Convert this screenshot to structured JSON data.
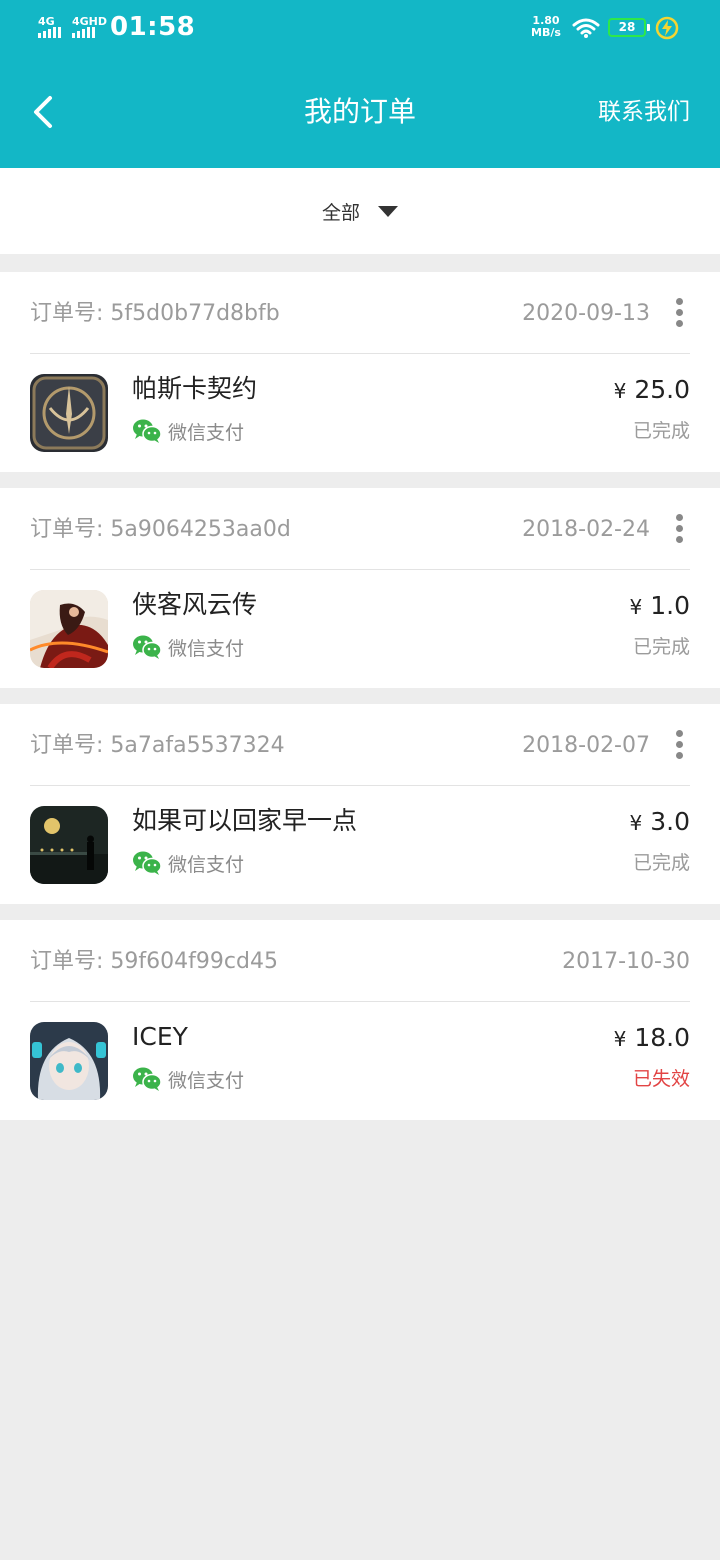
{
  "status_bar": {
    "sim1": "4G",
    "sim2": "4GHD",
    "time": "01:58",
    "net_speed_value": "1.80",
    "net_speed_unit": "MB/s",
    "battery": "28",
    "icons": [
      "signal-icon",
      "wifi-icon",
      "battery-icon",
      "charging-icon"
    ]
  },
  "nav": {
    "back_icon": "chevron-left-icon",
    "title": "我的订单",
    "contact": "联系我们"
  },
  "filter": {
    "selected": "全部",
    "icon": "caret-down-icon"
  },
  "orders": [
    {
      "order_label": "订单号:",
      "order_no": "5f5d0b77d8bfb",
      "date": "2020-09-13",
      "app_name": "帕斯卡契约",
      "payment": "微信支付",
      "currency": "¥",
      "price": "25.0",
      "status": "已完成",
      "has_more": true
    },
    {
      "order_label": "订单号:",
      "order_no": "5a9064253aa0d",
      "date": "2018-02-24",
      "app_name": "侠客风云传",
      "payment": "微信支付",
      "currency": "¥",
      "price": "1.0",
      "status": "已完成",
      "has_more": true
    },
    {
      "order_label": "订单号:",
      "order_no": "5a7afa5537324",
      "date": "2018-02-07",
      "app_name": "如果可以回家早一点",
      "payment": "微信支付",
      "currency": "¥",
      "price": "3.0",
      "status": "已完成",
      "has_more": true
    },
    {
      "order_label": "订单号:",
      "order_no": "59f604f99cd45",
      "date": "2017-10-30",
      "app_name": "ICEY",
      "payment": "微信支付",
      "currency": "¥",
      "price": "18.0",
      "status": "已失效",
      "has_more": false
    }
  ],
  "colors": {
    "header": "#13b7c6",
    "page_background": "#ededed",
    "status_failed": "#e24444",
    "wechat_green": "#3bb34a",
    "battery_outline": "#2ee84a"
  }
}
